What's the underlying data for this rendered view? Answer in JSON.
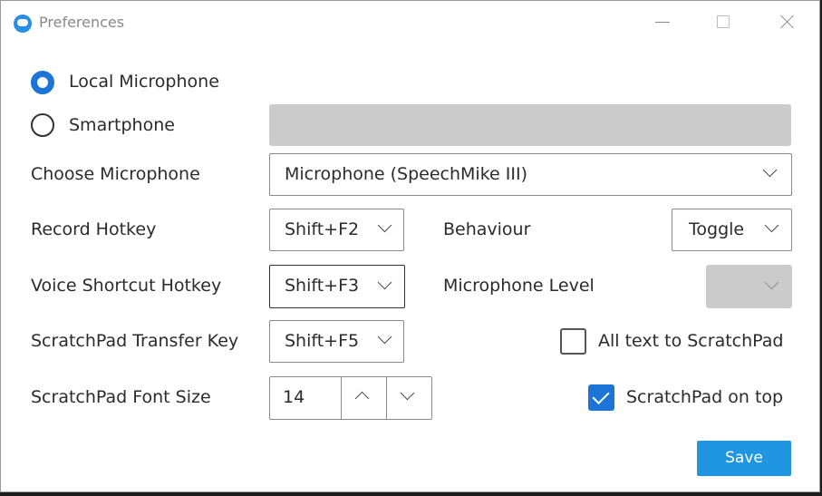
{
  "window": {
    "title": "Preferences"
  },
  "source": {
    "local_label": "Local Microphone",
    "smartphone_label": "Smartphone",
    "selected": "local",
    "smartphone_value": ""
  },
  "microphone": {
    "label": "Choose Microphone",
    "value": "Microphone (SpeechMike III)"
  },
  "record_hotkey": {
    "label": "Record Hotkey",
    "value": "Shift+F2"
  },
  "behaviour": {
    "label": "Behaviour",
    "value": "Toggle"
  },
  "voice_hotkey": {
    "label": "Voice Shortcut Hotkey",
    "value": "Shift+F3"
  },
  "mic_level": {
    "label": "Microphone Level",
    "value": ""
  },
  "transfer_key": {
    "label": "ScratchPad Transfer Key",
    "value": "Shift+F5"
  },
  "all_text": {
    "label": "All text to ScratchPad",
    "checked": false
  },
  "font_size": {
    "label": "ScratchPad Font Size",
    "value": "14"
  },
  "on_top": {
    "label": "ScratchPad on top",
    "checked": true
  },
  "save_label": "Save",
  "colors": {
    "accent": "#1b74d6",
    "save_button": "#2196e0",
    "disabled": "#cbcbcb"
  }
}
